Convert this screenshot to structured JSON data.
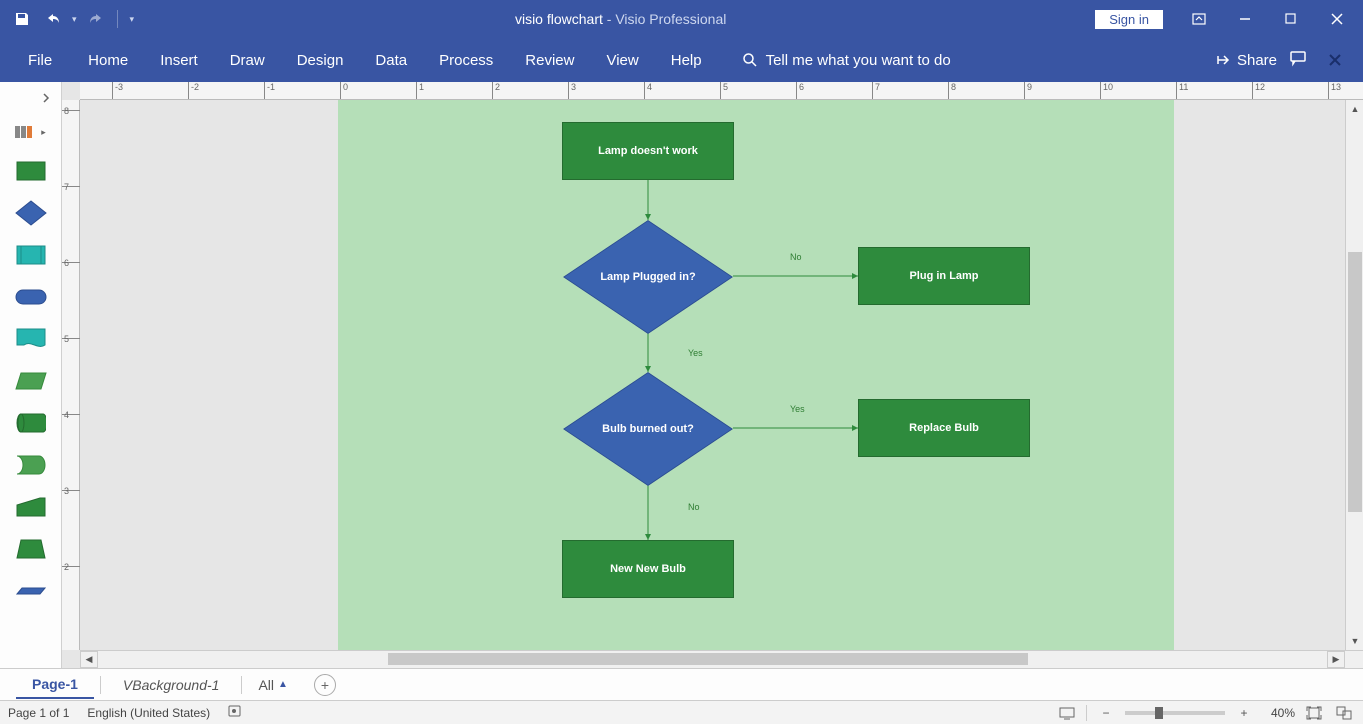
{
  "titlebar": {
    "doc_name": "visio flowchart",
    "separator": "  -  ",
    "app_name": "Visio Professional",
    "signin": "Sign in"
  },
  "ribbon": {
    "tabs": [
      "File",
      "Home",
      "Insert",
      "Draw",
      "Design",
      "Data",
      "Process",
      "Review",
      "View",
      "Help"
    ],
    "search_placeholder": "Tell me what you want to do",
    "share": "Share"
  },
  "ruler_h": {
    "labels": [
      "-3",
      "-2",
      "-1",
      "0",
      "1",
      "2",
      "3",
      "4",
      "5",
      "6",
      "7",
      "8",
      "9",
      "10",
      "11",
      "12",
      "13"
    ]
  },
  "ruler_v": {
    "labels": [
      "8",
      "7",
      "6",
      "5",
      "4",
      "3",
      "2"
    ]
  },
  "flowchart": {
    "nodes": {
      "n1_start": {
        "text": "Lamp doesn't work"
      },
      "n2_plugged": {
        "text": "Lamp Plugged in?"
      },
      "n3_plugin": {
        "text": "Plug in Lamp"
      },
      "n4_burned": {
        "text": "Bulb burned out?"
      },
      "n5_replace": {
        "text": "Replace Bulb"
      },
      "n6_newbulb": {
        "text": "New New Bulb"
      }
    },
    "labels": {
      "no1": "No",
      "yes1": "Yes",
      "yes2": "Yes",
      "no2": "No"
    }
  },
  "page_tabs": {
    "active": "Page-1",
    "background": "VBackground-1",
    "all": "All"
  },
  "statusbar": {
    "page_info": "Page 1 of 1",
    "language": "English (United States)",
    "zoom_pct": "40%"
  }
}
